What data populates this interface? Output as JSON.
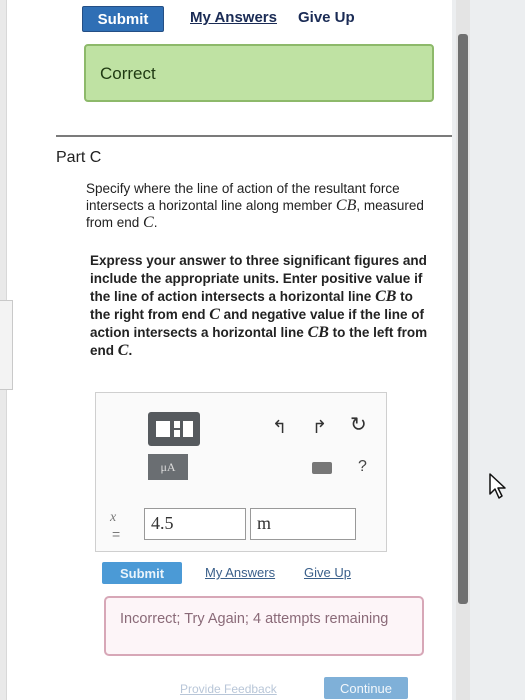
{
  "top_actions": {
    "submit_label": "Submit",
    "my_answers_label": "My Answers",
    "give_up_label": "Give Up"
  },
  "status": {
    "correct_text": "Correct"
  },
  "part": {
    "label": "Part C",
    "question": {
      "text1": "Specify where the line of action of the resultant force intersects a horizontal line along member ",
      "var_cb": "CB",
      "text2": ", measured from end ",
      "var_c": "C",
      "text3": "."
    },
    "instructions": {
      "t1": "Express your answer to three significant figures and include the appropriate units. Enter positive value if the line of action intersects a horizontal line ",
      "v1": "CB",
      "t2": " to the right from end ",
      "v2": "C",
      "t3": " and negative value if the line of action intersects a horizontal line ",
      "v3": "CB",
      "t4": " to the left from end ",
      "v4": "C",
      "t5": "."
    }
  },
  "toolbar": {
    "mu_label": "μA",
    "help_label": "?",
    "icons": [
      "templates-icon",
      "undo-icon",
      "redo-icon",
      "reset-icon",
      "keyboard-icon",
      "help-icon"
    ]
  },
  "answer": {
    "variable": "x",
    "equals": "=",
    "value": "4.5",
    "units": "m"
  },
  "bottom_actions": {
    "submit_label": "Submit",
    "my_answers_label": "My Answers",
    "give_up_label": "Give Up"
  },
  "feedback": {
    "incorrect_text": "Incorrect; Try Again; 4 attempts remaining"
  },
  "footer": {
    "provide_feedback_label": "Provide Feedback",
    "continue_label": "Continue"
  },
  "colors": {
    "primary_button": "#2f6fb5",
    "correct_bg": "#bfe2a3",
    "incorrect_border": "#d7a7b7"
  }
}
